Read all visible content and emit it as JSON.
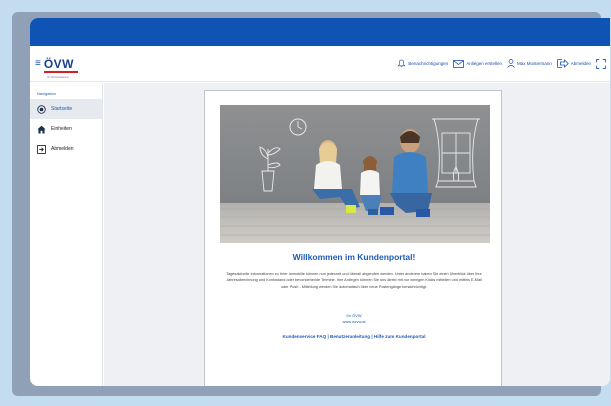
{
  "app": {
    "logo_text": "ÖVW",
    "logo_subtitle": "Ihr Wohnbaupartner"
  },
  "header": {
    "actions": [
      {
        "label": "Benachrichtigungen",
        "icon": "bell-icon"
      },
      {
        "label": "Anliegen erstellen",
        "icon": "envelope-icon"
      },
      {
        "label": "Max Mustermann",
        "icon": "user-icon"
      },
      {
        "label": "Abmelden",
        "icon": "logout-icon"
      },
      {
        "label": "",
        "icon": "fullscreen-icon"
      }
    ]
  },
  "sidebar": {
    "header": "Navigation",
    "items": [
      {
        "label": "Startseite",
        "icon": "target-icon",
        "active": true
      },
      {
        "label": "Einheiten",
        "icon": "house-icon",
        "active": false
      },
      {
        "label": "Abmelden",
        "icon": "logout-icon",
        "active": false
      }
    ]
  },
  "main": {
    "welcome_title": "Willkommen im Kundenportal!",
    "intro_text": "Tagesaktuelle Informationen zu Ihrer Immobilie können nun jederzeit und überall abgerufen werden. Unter anderem haben Sie einen Überblick über Ihre Jahresabrechnung und Kontostand oder bevorstehende Termine. Ihre Anliegen können Sie uns direkt mit nur wenigen Klicks mitteilen und mittels E-Mail oder Push - Mitteilung werden Sie automatisch über neue Postengänge benachrichtigt.",
    "signature_line1": "Ihr ÖVW",
    "signature_line2": "www.oevw.at",
    "footer_links": "Kundenservice FAQ | Benutzeranleitung | Hilfe zum Kundenportal"
  },
  "colors": {
    "titlebar": "#0f54b4",
    "accent": "#1f5bb5",
    "logo_red": "#d71f26"
  }
}
